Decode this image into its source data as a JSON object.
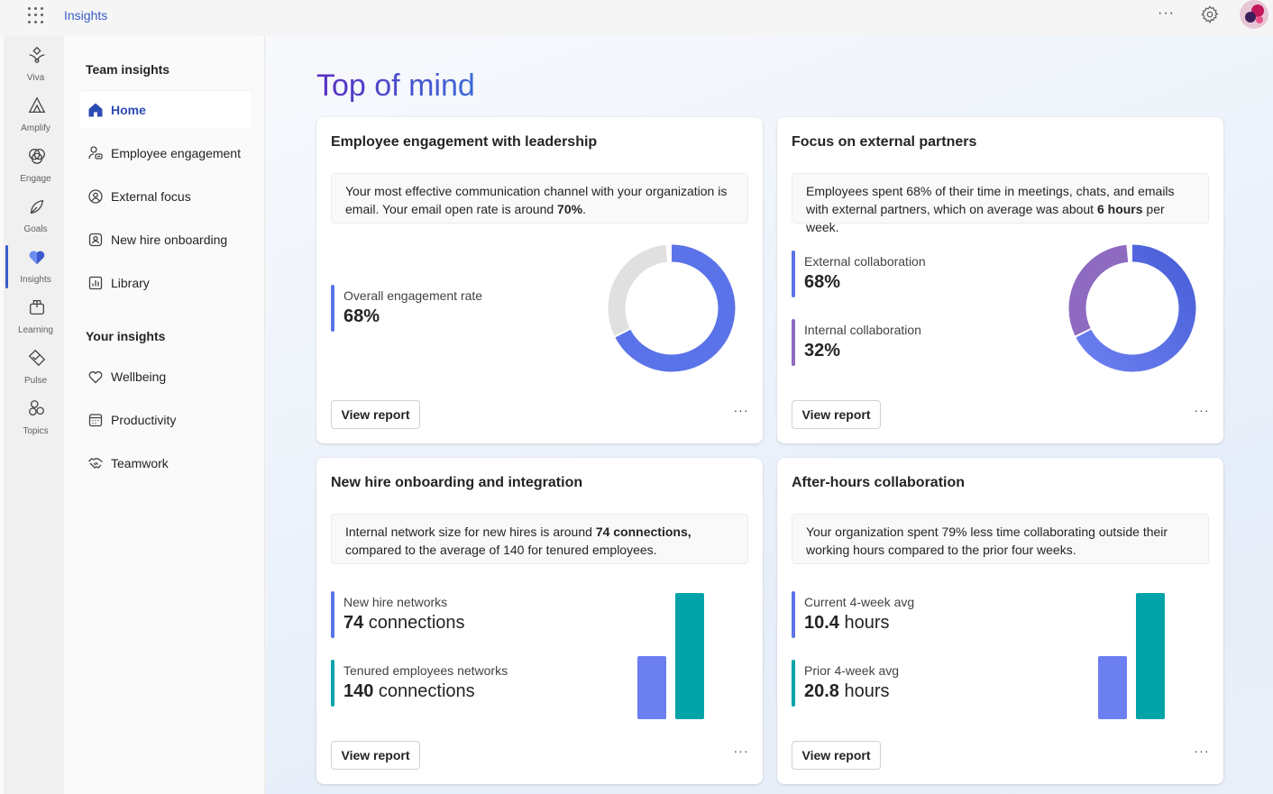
{
  "app": {
    "title": "Insights"
  },
  "rail": [
    {
      "label": "Viva",
      "icon": "viva-icon"
    },
    {
      "label": "Amplify",
      "icon": "amplify-icon"
    },
    {
      "label": "Engage",
      "icon": "engage-icon"
    },
    {
      "label": "Goals",
      "icon": "goals-icon"
    },
    {
      "label": "Insights",
      "icon": "insights-icon",
      "active": true
    },
    {
      "label": "Learning",
      "icon": "learning-icon"
    },
    {
      "label": "Pulse",
      "icon": "pulse-icon"
    },
    {
      "label": "Topics",
      "icon": "topics-icon"
    }
  ],
  "nav": {
    "team_heading": "Team insights",
    "team_items": [
      {
        "label": "Home",
        "icon": "home-icon",
        "active": true
      },
      {
        "label": "Employee engagement",
        "icon": "person-chat-icon"
      },
      {
        "label": "External focus",
        "icon": "globe-person-icon"
      },
      {
        "label": "New hire onboarding",
        "icon": "badge-icon"
      },
      {
        "label": "Library",
        "icon": "chart-icon"
      }
    ],
    "your_heading": "Your insights",
    "your_items": [
      {
        "label": "Wellbeing",
        "icon": "heart-icon"
      },
      {
        "label": "Productivity",
        "icon": "calendar-icon"
      },
      {
        "label": "Teamwork",
        "icon": "handshake-icon"
      }
    ]
  },
  "main": {
    "title": "Top of mind",
    "cards": [
      {
        "title": "Employee engagement with leadership",
        "desc_pre": "Your most effective communication channel with your organization is email. Your email open rate is around ",
        "desc_bold": "70%",
        "desc_post": ".",
        "metrics": [
          {
            "label": "Overall engagement rate",
            "value": "68%",
            "unit": "",
            "color": "#5b73e8"
          }
        ],
        "chart": {
          "type": "donut",
          "segments": [
            {
              "value": 68,
              "color": "#5b73e8"
            },
            {
              "value": 32,
              "color": "#e0e0e0"
            }
          ]
        },
        "button": "View report"
      },
      {
        "title": "Focus on external partners",
        "desc_pre": "Employees spent 68% of their time in meetings, chats, and emails with external partners, which on average was about ",
        "desc_bold": "6 hours",
        "desc_post": " per week.",
        "metrics": [
          {
            "label": "External collaboration",
            "value": "68%",
            "unit": "",
            "color": "#5b73e8"
          },
          {
            "label": "Internal collaboration",
            "value": "32%",
            "unit": "",
            "color": "#8e6ac1"
          }
        ],
        "chart": {
          "type": "donut",
          "segments": [
            {
              "value": 68,
              "color": "#5b73e8"
            },
            {
              "value": 32,
              "color": "#8e6ac1"
            }
          ]
        },
        "button": "View report"
      },
      {
        "title": "New hire onboarding and integration",
        "desc_pre": "Internal network size for new hires is around ",
        "desc_bold": "74 connections,",
        "desc_post": " compared to the average of 140 for tenured employees.",
        "metrics": [
          {
            "label": "New hire networks",
            "value": "74",
            "unit": " connections",
            "color": "#5b73e8"
          },
          {
            "label": "Tenured employees networks",
            "value": "140",
            "unit": " connections",
            "color": "#00a3a8"
          }
        ],
        "chart": {
          "type": "bar",
          "values": [
            74,
            140
          ],
          "colors": [
            "#6b7ff0",
            "#00a3a8"
          ]
        },
        "button": "View report"
      },
      {
        "title": "After-hours collaboration",
        "desc_pre": "Your organization spent 79% less time collaborating outside their working hours compared to the prior four weeks.",
        "desc_bold": "",
        "desc_post": "",
        "metrics": [
          {
            "label": "Current 4-week avg",
            "value": "10.4",
            "unit": " hours",
            "color": "#5b73e8"
          },
          {
            "label": "Prior 4-week avg",
            "value": "20.8",
            "unit": " hours",
            "color": "#00a3a8"
          }
        ],
        "chart": {
          "type": "bar",
          "values": [
            10.4,
            20.8
          ],
          "colors": [
            "#6b7ff0",
            "#00a3a8"
          ]
        },
        "button": "View report"
      }
    ]
  }
}
